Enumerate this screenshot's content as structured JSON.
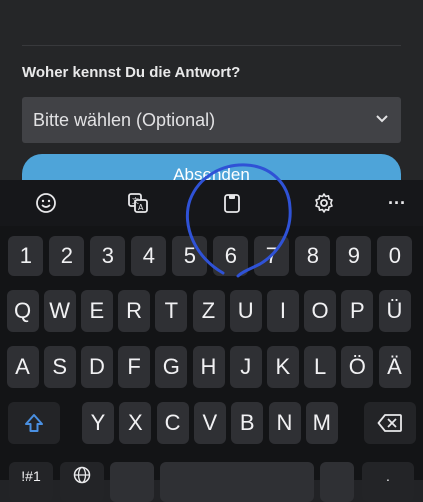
{
  "form": {
    "question": "Woher kennst Du die Antwort?",
    "select_value": "Bitte wählen (Optional)",
    "submit_label": "Absenden"
  },
  "toolbar": {
    "items": [
      "emoji-icon",
      "translate-icon",
      "clipboard-icon",
      "settings-icon",
      "more-icon"
    ],
    "more_label": "···"
  },
  "keyboard": {
    "row_numbers": [
      "1",
      "2",
      "3",
      "4",
      "5",
      "6",
      "7",
      "8",
      "9",
      "0"
    ],
    "row1": [
      "Q",
      "W",
      "E",
      "R",
      "T",
      "Z",
      "U",
      "I",
      "O",
      "P",
      "Ü"
    ],
    "row2": [
      "A",
      "S",
      "D",
      "F",
      "G",
      "H",
      "J",
      "K",
      "L",
      "Ö",
      "Ä"
    ],
    "row3": [
      "Y",
      "X",
      "C",
      "V",
      "B",
      "N",
      "M"
    ],
    "bottom_left": "!#1",
    "bottom_right": "."
  },
  "colors": {
    "accent_button": "#4ea4d9",
    "shift_icon": "#4a90e2",
    "annotation": "#2f52d6"
  }
}
